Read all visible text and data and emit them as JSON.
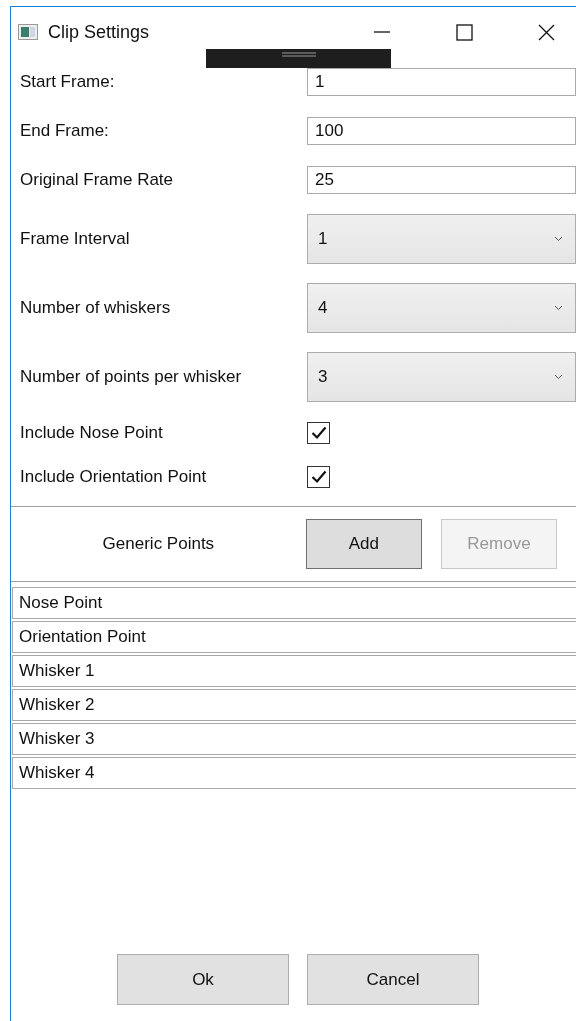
{
  "window": {
    "title": "Clip Settings"
  },
  "fields": [
    {
      "kind": "text",
      "label": "Start Frame:",
      "value": "1"
    },
    {
      "kind": "text",
      "label": "End Frame:",
      "value": "100"
    },
    {
      "kind": "text",
      "label": "Original Frame Rate",
      "value": "25"
    },
    {
      "kind": "dropdown",
      "label": "Frame Interval",
      "value": "1"
    },
    {
      "kind": "dropdown",
      "label": "Number of whiskers",
      "value": "4"
    },
    {
      "kind": "dropdown",
      "label": "Number of points per whisker",
      "value": "3"
    },
    {
      "kind": "checkbox",
      "label": "Include Nose Point",
      "checked": true
    },
    {
      "kind": "checkbox",
      "label": "Include Orientation Point",
      "checked": true
    }
  ],
  "generic_points": {
    "label": "Generic Points",
    "buttons": [
      {
        "label": "Add",
        "disabled": false
      },
      {
        "label": "Remove",
        "disabled": true
      }
    ]
  },
  "points_list": [
    "Nose Point",
    "Orientation Point",
    "Whisker 1",
    "Whisker 2",
    "Whisker 3",
    "Whisker 4"
  ],
  "buttons": [
    "Ok",
    "Cancel"
  ]
}
